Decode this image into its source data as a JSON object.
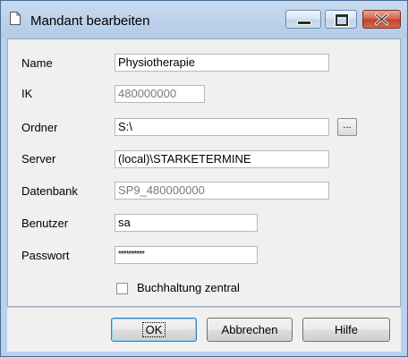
{
  "window": {
    "title": "Mandant bearbeiten",
    "icon": "document-icon",
    "controls": [
      "minimize-icon",
      "maximize-icon",
      "close-icon"
    ]
  },
  "form": {
    "name": {
      "label": "Name",
      "value": "Physiotherapie"
    },
    "ik": {
      "label": "IK",
      "value": "480000000"
    },
    "ordner": {
      "label": "Ordner",
      "value": "S:\\",
      "browse_label": "..."
    },
    "server": {
      "label": "Server",
      "value": "(local)\\STARKETERMINE"
    },
    "datenbank": {
      "label": "Datenbank",
      "value": "SP9_480000000"
    },
    "benutzer": {
      "label": "Benutzer",
      "value": "sa"
    },
    "passwort": {
      "label": "Passwort",
      "value": "**********"
    },
    "buchhaltung": {
      "label": "Buchhaltung zentral",
      "checked": false
    }
  },
  "buttons": {
    "ok": "OK",
    "cancel": "Abbrechen",
    "help": "Hilfe"
  }
}
